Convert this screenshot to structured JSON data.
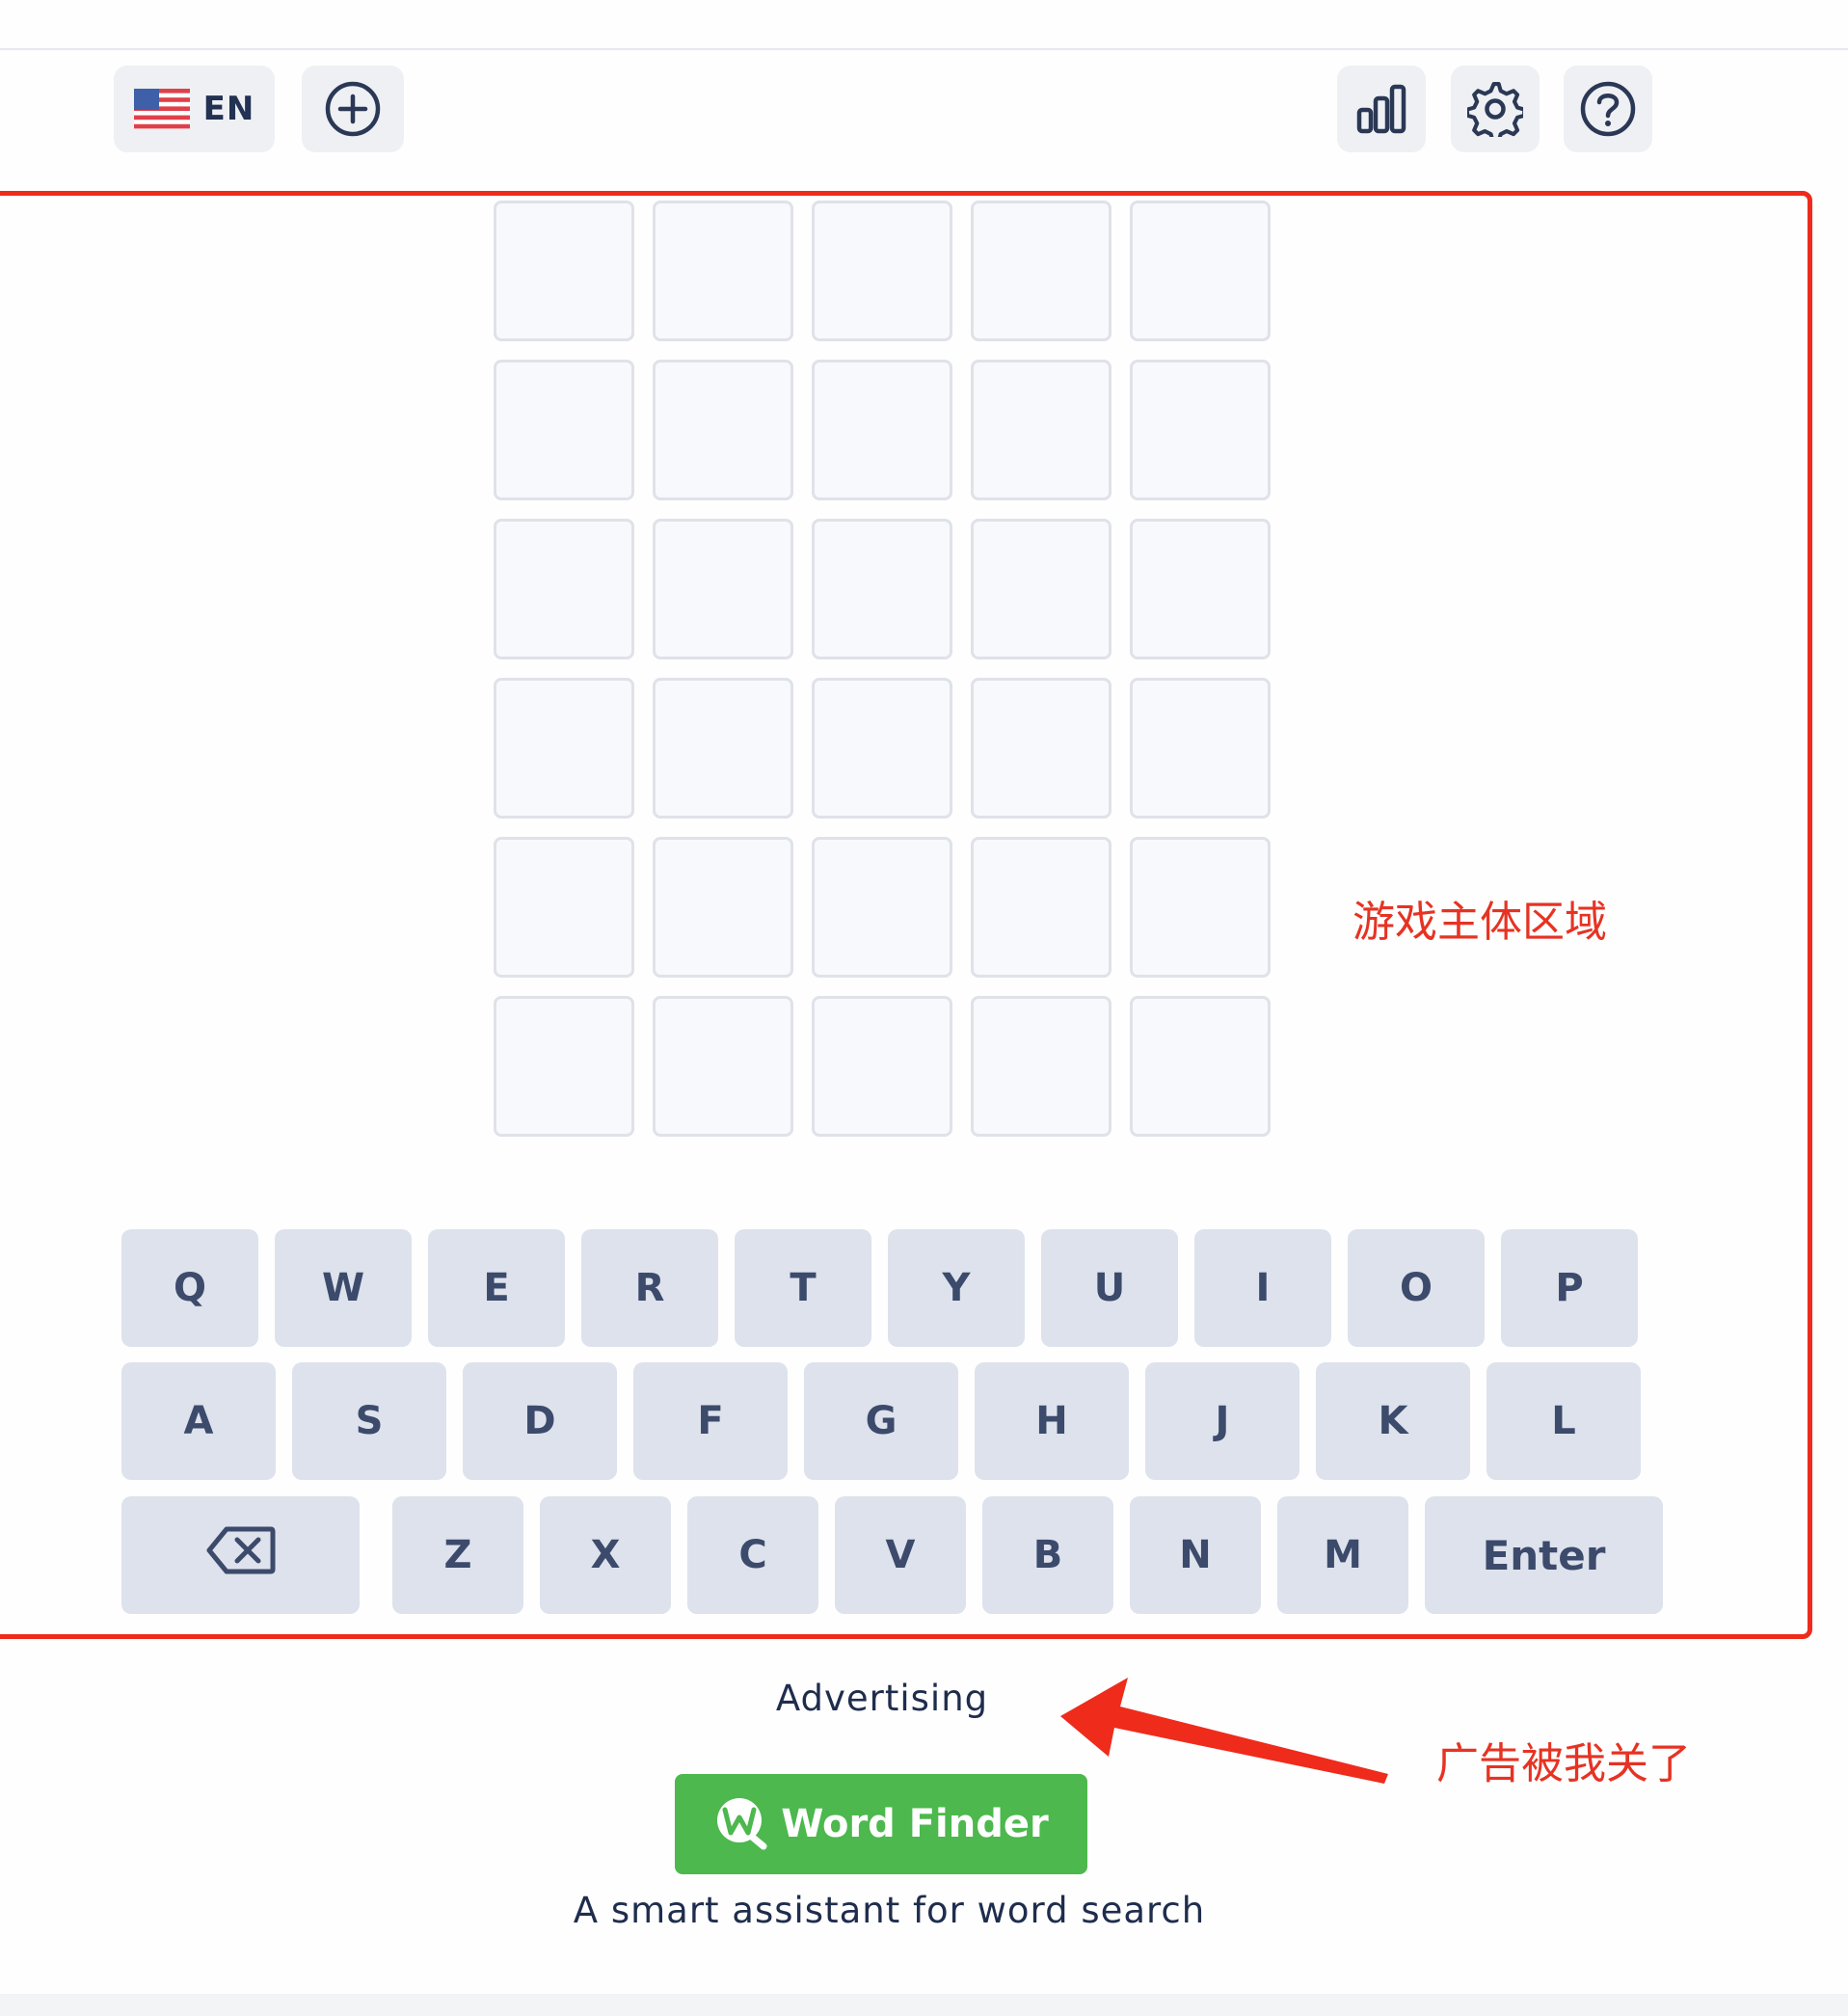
{
  "header": {
    "language_code": "EN",
    "language_flag_icon": "us-flag-icon",
    "add_icon": "plus-circle-icon",
    "stats_icon": "bar-chart-icon",
    "settings_icon": "gear-icon",
    "help_icon": "question-circle-icon"
  },
  "board": {
    "rows": 6,
    "columns": 5,
    "tiles": [
      [
        "",
        "",
        "",
        "",
        ""
      ],
      [
        "",
        "",
        "",
        "",
        ""
      ],
      [
        "",
        "",
        "",
        "",
        ""
      ],
      [
        "",
        "",
        "",
        "",
        ""
      ],
      [
        "",
        "",
        "",
        "",
        ""
      ],
      [
        "",
        "",
        "",
        "",
        ""
      ]
    ]
  },
  "keyboard": {
    "row1": [
      "Q",
      "W",
      "E",
      "R",
      "T",
      "Y",
      "U",
      "I",
      "O",
      "P"
    ],
    "row2": [
      "A",
      "S",
      "D",
      "F",
      "G",
      "H",
      "J",
      "K",
      "L"
    ],
    "row3": [
      "Z",
      "X",
      "C",
      "V",
      "B",
      "N",
      "M"
    ],
    "backspace_icon": "backspace-icon",
    "enter_label": "Enter"
  },
  "annotations": {
    "game_area_label": "游戏主体区域",
    "ad_closed_label": "广告被我关了",
    "highlight_color": "#ef2b1c",
    "annotation_text_color": "#e63323"
  },
  "footer": {
    "advertising_label": "Advertising",
    "word_finder_label": "Word Finder",
    "word_finder_icon": "word-finder-logo-icon",
    "word_finder_tagline": "A smart assistant for word search",
    "word_finder_color": "#4cb84d"
  },
  "colors": {
    "tile_border": "#dfe2e8",
    "key_background": "#dde2ec",
    "key_text": "#3c4a6b",
    "header_button_background": "#eef0f4"
  }
}
